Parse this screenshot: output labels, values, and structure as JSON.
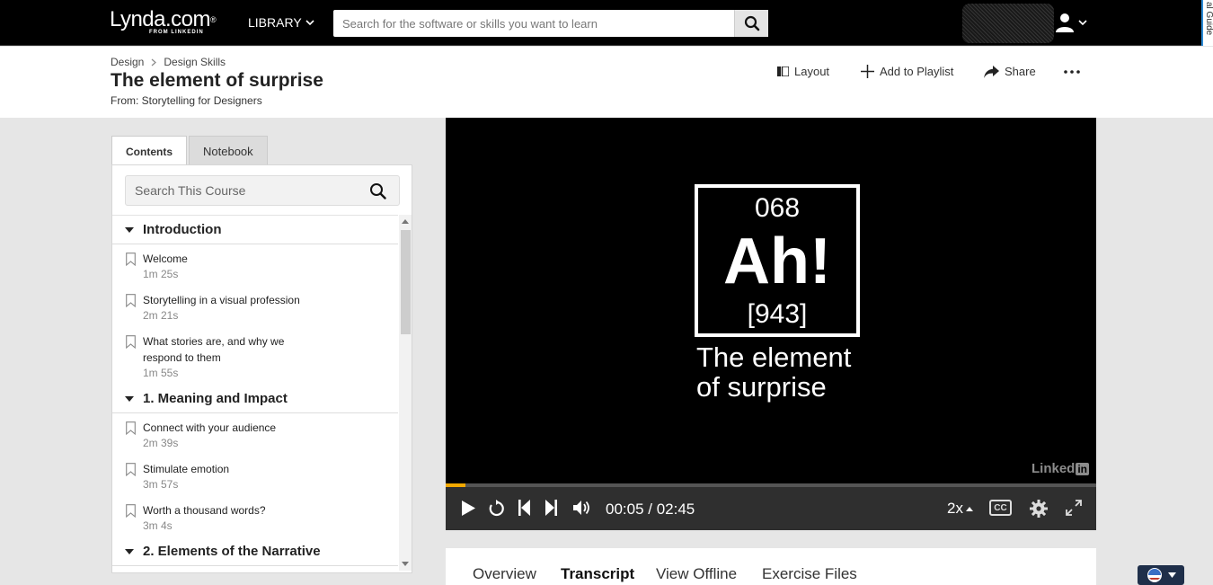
{
  "topbar": {
    "logo_text": "Lynda.com",
    "logo_reg": "®",
    "logo_sub": "FROM LINKEDIN",
    "library_label": "LIBRARY",
    "search_placeholder": "Search for the software or skills you want to learn",
    "edge_text": "al Guide"
  },
  "header": {
    "breadcrumb": [
      "Design",
      "Design Skills"
    ],
    "breadcrumb_sep": ">",
    "title": "The element of surprise",
    "from": "From: Storytelling for Designers",
    "actions": {
      "layout": "Layout",
      "add_playlist": "Add to Playlist",
      "share": "Share"
    }
  },
  "sidebar": {
    "tabs": [
      "Contents",
      "Notebook"
    ],
    "active_tab": "Contents",
    "search_placeholder": "Search This Course",
    "sections": [
      {
        "title": "Introduction",
        "items": [
          {
            "title": "Welcome",
            "duration": "1m 25s"
          },
          {
            "title": "Storytelling in a visual profession",
            "duration": "2m 21s"
          },
          {
            "title": "What stories are, and why we respond to them",
            "duration": "1m 55s"
          }
        ]
      },
      {
        "title": "1. Meaning and Impact",
        "items": [
          {
            "title": "Connect with your audience",
            "duration": "2m 39s"
          },
          {
            "title": "Stimulate emotion",
            "duration": "3m 57s"
          },
          {
            "title": "Worth a thousand words?",
            "duration": "3m 4s"
          }
        ]
      },
      {
        "title": "2. Elements of the Narrative",
        "items": []
      }
    ]
  },
  "video": {
    "element_number": "068",
    "element_symbol": "Ah!",
    "element_mass": "[943]",
    "caption_line1": "The element",
    "caption_line2": "of surprise",
    "watermark": "Linked",
    "watermark_in": "in",
    "progress_fraction": 0.03,
    "current_time": "00:05",
    "total_time": "02:45",
    "time_display": "00:05 / 02:45",
    "speed": "2x",
    "cc_label": "CC",
    "accent_color": "#f2a900"
  },
  "bottom_tabs": {
    "items": [
      "Overview",
      "Transcript",
      "View Offline",
      "Exercise Files"
    ],
    "active": "Transcript"
  },
  "icons": [
    "search-icon",
    "user-icon",
    "chevron-down-icon",
    "layout-icon",
    "plus-icon",
    "share-icon",
    "more-icon",
    "bookmark-icon",
    "caret-down-icon",
    "play-icon",
    "replay-icon",
    "skip-back-icon",
    "skip-forward-icon",
    "volume-icon",
    "settings-icon",
    "fullscreen-icon",
    "flag-icon"
  ]
}
